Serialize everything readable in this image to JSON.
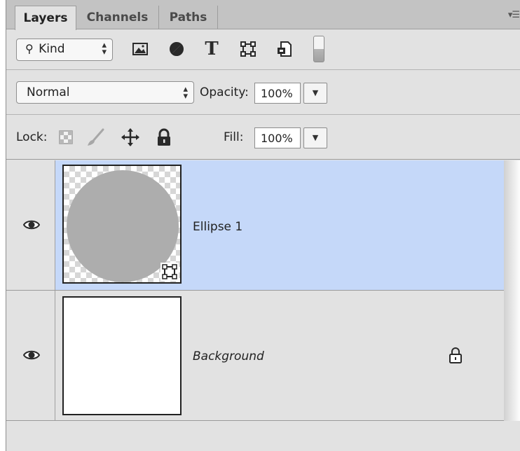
{
  "tabs": [
    "Layers",
    "Channels",
    "Paths"
  ],
  "filter": {
    "kind_label": "Kind",
    "icons": [
      "pixel-layer-filter-icon",
      "adjustment-layer-filter-icon",
      "type-layer-filter-icon",
      "shape-layer-filter-icon",
      "smart-object-filter-icon",
      "filter-toggle-switch"
    ]
  },
  "blend": {
    "mode": "Normal",
    "opacity_label": "Opacity:",
    "opacity_value": "100%"
  },
  "lock": {
    "label": "Lock:",
    "fill_label": "Fill:",
    "fill_value": "100%"
  },
  "layers": [
    {
      "name": "Ellipse 1",
      "visible": true,
      "selected": true,
      "type": "shape"
    },
    {
      "name": "Background",
      "visible": true,
      "selected": false,
      "locked": true,
      "type": "background"
    }
  ],
  "colors": {
    "selection": "#c5d8f9",
    "panel": "#e2e2e2",
    "ellipse_fill": "#adadad"
  }
}
